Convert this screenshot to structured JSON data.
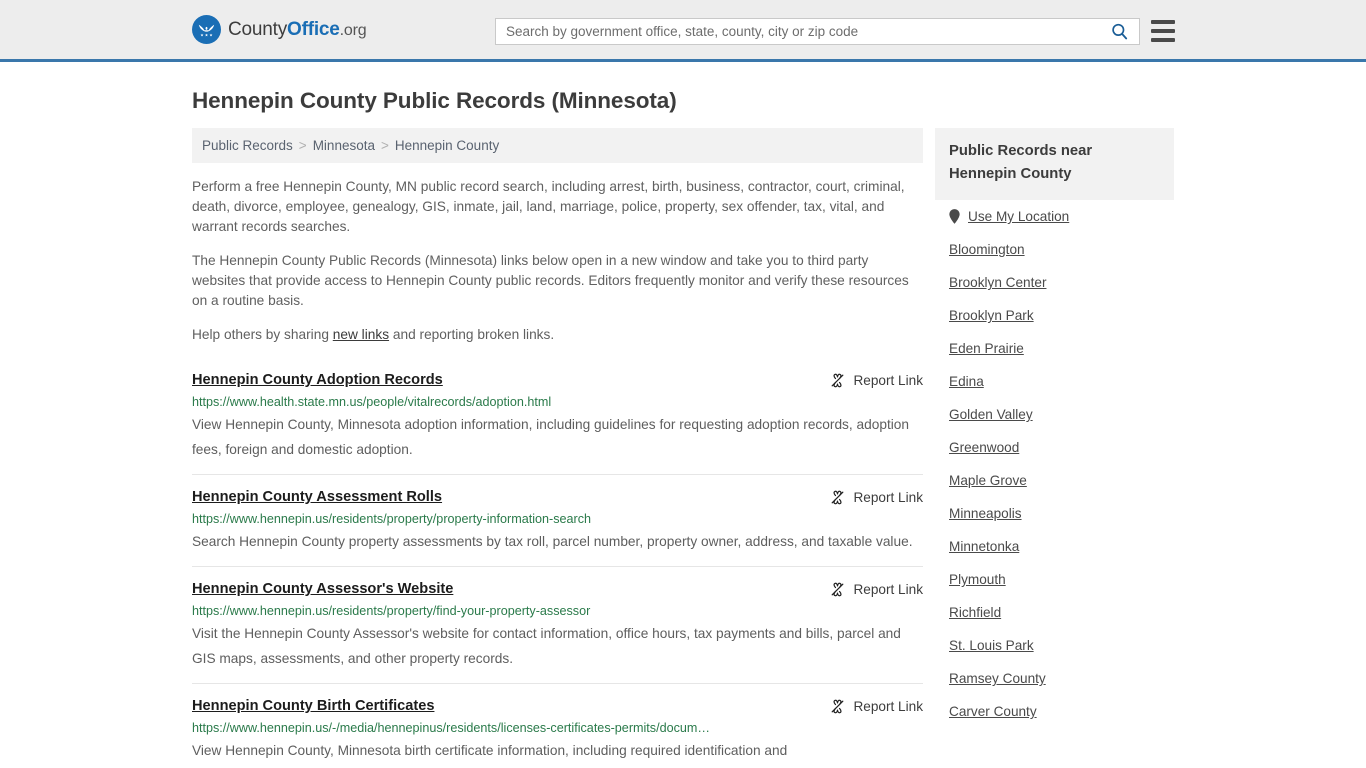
{
  "header": {
    "brand": {
      "part1": "County",
      "part2": "Office",
      "part3": ".org",
      "logo_icon": "eagle-stars-logo"
    },
    "search": {
      "placeholder": "Search by government office, state, county, city or zip code",
      "value": "",
      "search_icon": "search-icon"
    },
    "menu_icon": "hamburger-menu-icon",
    "accent_color": "#3a77ab"
  },
  "page": {
    "title": "Hennepin County Public Records (Minnesota)"
  },
  "breadcrumb": {
    "items": [
      {
        "label": "Public Records"
      },
      {
        "label": "Minnesota"
      },
      {
        "label": "Hennepin County"
      }
    ],
    "separator": ">"
  },
  "intro": {
    "p1": "Perform a free Hennepin County, MN public record search, including arrest, birth, business, contractor, court, criminal, death, divorce, employee, genealogy, GIS, inmate, jail, land, marriage, police, property, sex offender, tax, vital, and warrant records searches.",
    "p2": "The Hennepin County Public Records (Minnesota) links below open in a new window and take you to third party websites that provide access to Hennepin County public records. Editors frequently monitor and verify these resources on a routine basis.",
    "p3_before": "Help others by sharing ",
    "p3_link": "new links",
    "p3_after": " and reporting broken links."
  },
  "records": {
    "report_label": "Report Link",
    "report_icon": "broken-link-icon",
    "items": [
      {
        "title": "Hennepin County Adoption Records",
        "url": "https://www.health.state.mn.us/people/vitalrecords/adoption.html",
        "description": "View Hennepin County, Minnesota adoption information, including guidelines for requesting adoption records, adoption fees, foreign and domestic adoption."
      },
      {
        "title": "Hennepin County Assessment Rolls",
        "url": "https://www.hennepin.us/residents/property/property-information-search",
        "description": "Search Hennepin County property assessments by tax roll, parcel number, property owner, address, and taxable value."
      },
      {
        "title": "Hennepin County Assessor's Website",
        "url": "https://www.hennepin.us/residents/property/find-your-property-assessor",
        "description": "Visit the Hennepin County Assessor's website for contact information, office hours, tax payments and bills, parcel and GIS maps, assessments, and other property records."
      },
      {
        "title": "Hennepin County Birth Certificates",
        "url": "https://www.hennepin.us/-/media/hennepinus/residents/licenses-certificates-permits/docum…",
        "description": "View Hennepin County, Minnesota birth certificate information, including required identification and"
      }
    ]
  },
  "sidebar": {
    "heading": "Public Records near Hennepin County",
    "location_icon": "map-pin-icon",
    "items": [
      {
        "label": "Use My Location",
        "icon": "map-pin-icon"
      },
      {
        "label": "Bloomington"
      },
      {
        "label": "Brooklyn Center"
      },
      {
        "label": "Brooklyn Park"
      },
      {
        "label": "Eden Prairie"
      },
      {
        "label": "Edina"
      },
      {
        "label": "Golden Valley"
      },
      {
        "label": "Greenwood"
      },
      {
        "label": "Maple Grove"
      },
      {
        "label": "Minneapolis"
      },
      {
        "label": "Minnetonka"
      },
      {
        "label": "Plymouth"
      },
      {
        "label": "Richfield"
      },
      {
        "label": "St. Louis Park"
      },
      {
        "label": "Ramsey County"
      },
      {
        "label": "Carver County"
      }
    ]
  }
}
